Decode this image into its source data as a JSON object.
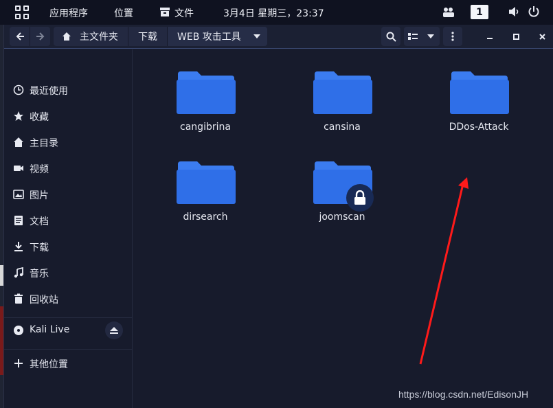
{
  "topbar": {
    "apps_label": "应用程序",
    "places_label": "位置",
    "files_label": "文件",
    "clock": "3月4日 星期三，23:37",
    "workspace": "1"
  },
  "headerbar": {
    "breadcrumbs": [
      "主文件夹",
      "下载",
      "WEB 攻击工具"
    ]
  },
  "sidebar": {
    "items": [
      {
        "label": "最近使用",
        "icon": "clock-icon"
      },
      {
        "label": "收藏",
        "icon": "star-icon"
      },
      {
        "label": "主目录",
        "icon": "home-icon"
      },
      {
        "label": "视频",
        "icon": "video-icon"
      },
      {
        "label": "图片",
        "icon": "image-icon"
      },
      {
        "label": "文档",
        "icon": "document-icon"
      },
      {
        "label": "下载",
        "icon": "download-icon"
      },
      {
        "label": "音乐",
        "icon": "music-icon"
      },
      {
        "label": "回收站",
        "icon": "trash-icon"
      }
    ],
    "device": {
      "label": "Kali Live",
      "icon": "disc-icon"
    },
    "other": {
      "label": "其他位置",
      "icon": "plus-icon"
    }
  },
  "files": [
    {
      "name": "cangibrina",
      "locked": false
    },
    {
      "name": "cansina",
      "locked": false
    },
    {
      "name": "DDos-Attack",
      "locked": false
    },
    {
      "name": "dirsearch",
      "locked": false
    },
    {
      "name": "joomscan",
      "locked": true
    }
  ],
  "colors": {
    "folder": "#2f6fe8",
    "folder_tab": "#3b7cf0",
    "arrow": "#ff1a1a"
  },
  "watermark": "https://blog.csdn.net/EdisonJH"
}
